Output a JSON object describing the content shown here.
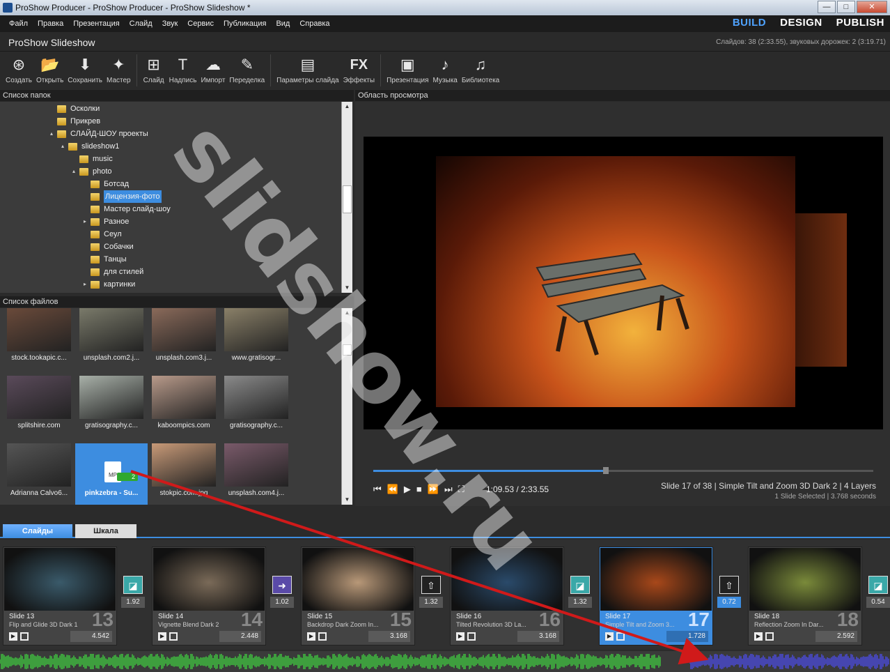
{
  "window": {
    "title": "ProShow Producer - ProShow Producer - ProShow Slideshow *"
  },
  "menu": [
    "Файл",
    "Правка",
    "Презентация",
    "Слайд",
    "Звук",
    "Сервис",
    "Публикация",
    "Вид",
    "Справка"
  ],
  "modes": {
    "build": "BUILD",
    "design": "DESIGN",
    "publish": "PUBLISH",
    "active": "BUILD"
  },
  "project": {
    "title": "ProShow Slideshow",
    "info": "Слайдов: 38 (2:33.55), звуковых дорожек: 2 (3:19.71)"
  },
  "toolbar": [
    {
      "label": "Создать",
      "icon": "create-icon"
    },
    {
      "label": "Открыть",
      "icon": "open-folder-icon"
    },
    {
      "label": "Сохранить",
      "icon": "save-icon"
    },
    {
      "label": "Мастер",
      "icon": "wizard-icon"
    },
    {
      "label": "Слайд",
      "icon": "add-slide-icon"
    },
    {
      "label": "Надпись",
      "icon": "caption-icon"
    },
    {
      "label": "Импорт",
      "icon": "import-icon"
    },
    {
      "label": "Переделка",
      "icon": "remix-icon"
    },
    {
      "label": "Параметры слайда",
      "icon": "slide-options-icon"
    },
    {
      "label": "Эффекты",
      "icon": "fx-icon"
    },
    {
      "label": "Презентация",
      "icon": "presentation-icon"
    },
    {
      "label": "Музыка",
      "icon": "music-icon"
    },
    {
      "label": "Библиотека",
      "icon": "library-icon"
    }
  ],
  "folders": {
    "header": "Список папок",
    "items": [
      {
        "label": "Осколки",
        "indent": 0,
        "expand": ""
      },
      {
        "label": "Прикрев",
        "indent": 0,
        "expand": ""
      },
      {
        "label": "СЛАЙД-ШОУ проекты",
        "indent": 0,
        "expand": "▴"
      },
      {
        "label": "slideshow1",
        "indent": 1,
        "expand": "▴"
      },
      {
        "label": "music",
        "indent": 2,
        "expand": ""
      },
      {
        "label": "photo",
        "indent": 2,
        "expand": "▴"
      },
      {
        "label": "Ботсад",
        "indent": 3,
        "expand": ""
      },
      {
        "label": "Лицензия-фото",
        "indent": 3,
        "expand": "",
        "selected": true
      },
      {
        "label": "Мастер слайд-шоу",
        "indent": 3,
        "expand": ""
      },
      {
        "label": "Разное",
        "indent": 3,
        "expand": "▸"
      },
      {
        "label": "Сеул",
        "indent": 3,
        "expand": ""
      },
      {
        "label": "Собачки",
        "indent": 3,
        "expand": ""
      },
      {
        "label": "Танцы",
        "indent": 3,
        "expand": ""
      },
      {
        "label": "для стилей",
        "indent": 3,
        "expand": ""
      },
      {
        "label": "картинки",
        "indent": 3,
        "expand": "▸"
      }
    ]
  },
  "files": {
    "header": "Список файлов",
    "items": [
      {
        "caption": "stock.tookapic.c...",
        "color": "#6a4a3a"
      },
      {
        "caption": "unsplash.com2.j...",
        "color": "#7a7a6a"
      },
      {
        "caption": "unsplash.com3.j...",
        "color": "#8a6a5a"
      },
      {
        "caption": "www.gratisogr...",
        "color": "#8a8068"
      },
      {
        "caption": "splitshire.com",
        "color": "#5a4a5a"
      },
      {
        "caption": "gratisography.c...",
        "color": "#a8b0a8"
      },
      {
        "caption": "kaboompics.com",
        "color": "#b89a8a"
      },
      {
        "caption": "gratisography.c...",
        "color": "#8a8a8a"
      },
      {
        "caption": "Adrianna Calvo6...",
        "color": "#555555"
      },
      {
        "caption": "pinkzebra - Su...",
        "color": "#3d8de0",
        "selected": true,
        "badge": "2"
      },
      {
        "caption": "stokpic.com.jpg",
        "color": "#c89a78"
      },
      {
        "caption": "unsplash.com4.j...",
        "color": "#7a5a6a"
      }
    ]
  },
  "preview": {
    "header": "Область просмотра",
    "time": "1:09.53 / 2:33.55",
    "progress": 0.46,
    "slide_info": "Slide 17 of 38  |  Simple Tilt and Zoom 3D Dark 2  |  4 Layers",
    "selection_info": "1 Slide Selected  |  3.768 seconds"
  },
  "tabs": {
    "slides": "Слайды",
    "timeline": "Шкала"
  },
  "slides": [
    {
      "name": "Slide 13",
      "effect": "Flip and Glide 3D Dark 1",
      "num": "13",
      "dur": "4.542",
      "trans": "1.92",
      "tcolor": "#3aa8a8",
      "color": "#3a5a6a"
    },
    {
      "name": "Slide 14",
      "effect": "Vignette Blend Dark 2",
      "num": "14",
      "dur": "2.448",
      "trans": "1.02",
      "tcolor": "#5a4aa8",
      "color": "#7a6a58"
    },
    {
      "name": "Slide 15",
      "effect": "Backdrop Dark Zoom In...",
      "num": "15",
      "dur": "3.168",
      "trans": "1.32",
      "tcolor": "#222222",
      "color": "#b89878"
    },
    {
      "name": "Slide 16",
      "effect": "Tilted Revolution 3D La...",
      "num": "16",
      "dur": "3.168",
      "trans": "1.32",
      "tcolor": "#3aa8a8",
      "color": "#2a4a6a"
    },
    {
      "name": "Slide 17",
      "effect": "Simple Tilt and Zoom 3...",
      "num": "17",
      "dur": "1.728",
      "trans": "0.72",
      "tcolor": "#222222",
      "color": "#a8481a",
      "current": true
    },
    {
      "name": "Slide 18",
      "effect": "Reflection Zoom In Dar...",
      "num": "18",
      "dur": "2.592",
      "trans": "0.54",
      "tcolor": "#3aa8a8",
      "color": "#7a8a3a"
    }
  ],
  "watermark": "slidshow.ru",
  "colors": {
    "accent": "#3d8de0",
    "audio_green": "#3fc03f",
    "audio_blue": "#4a4ad8"
  }
}
